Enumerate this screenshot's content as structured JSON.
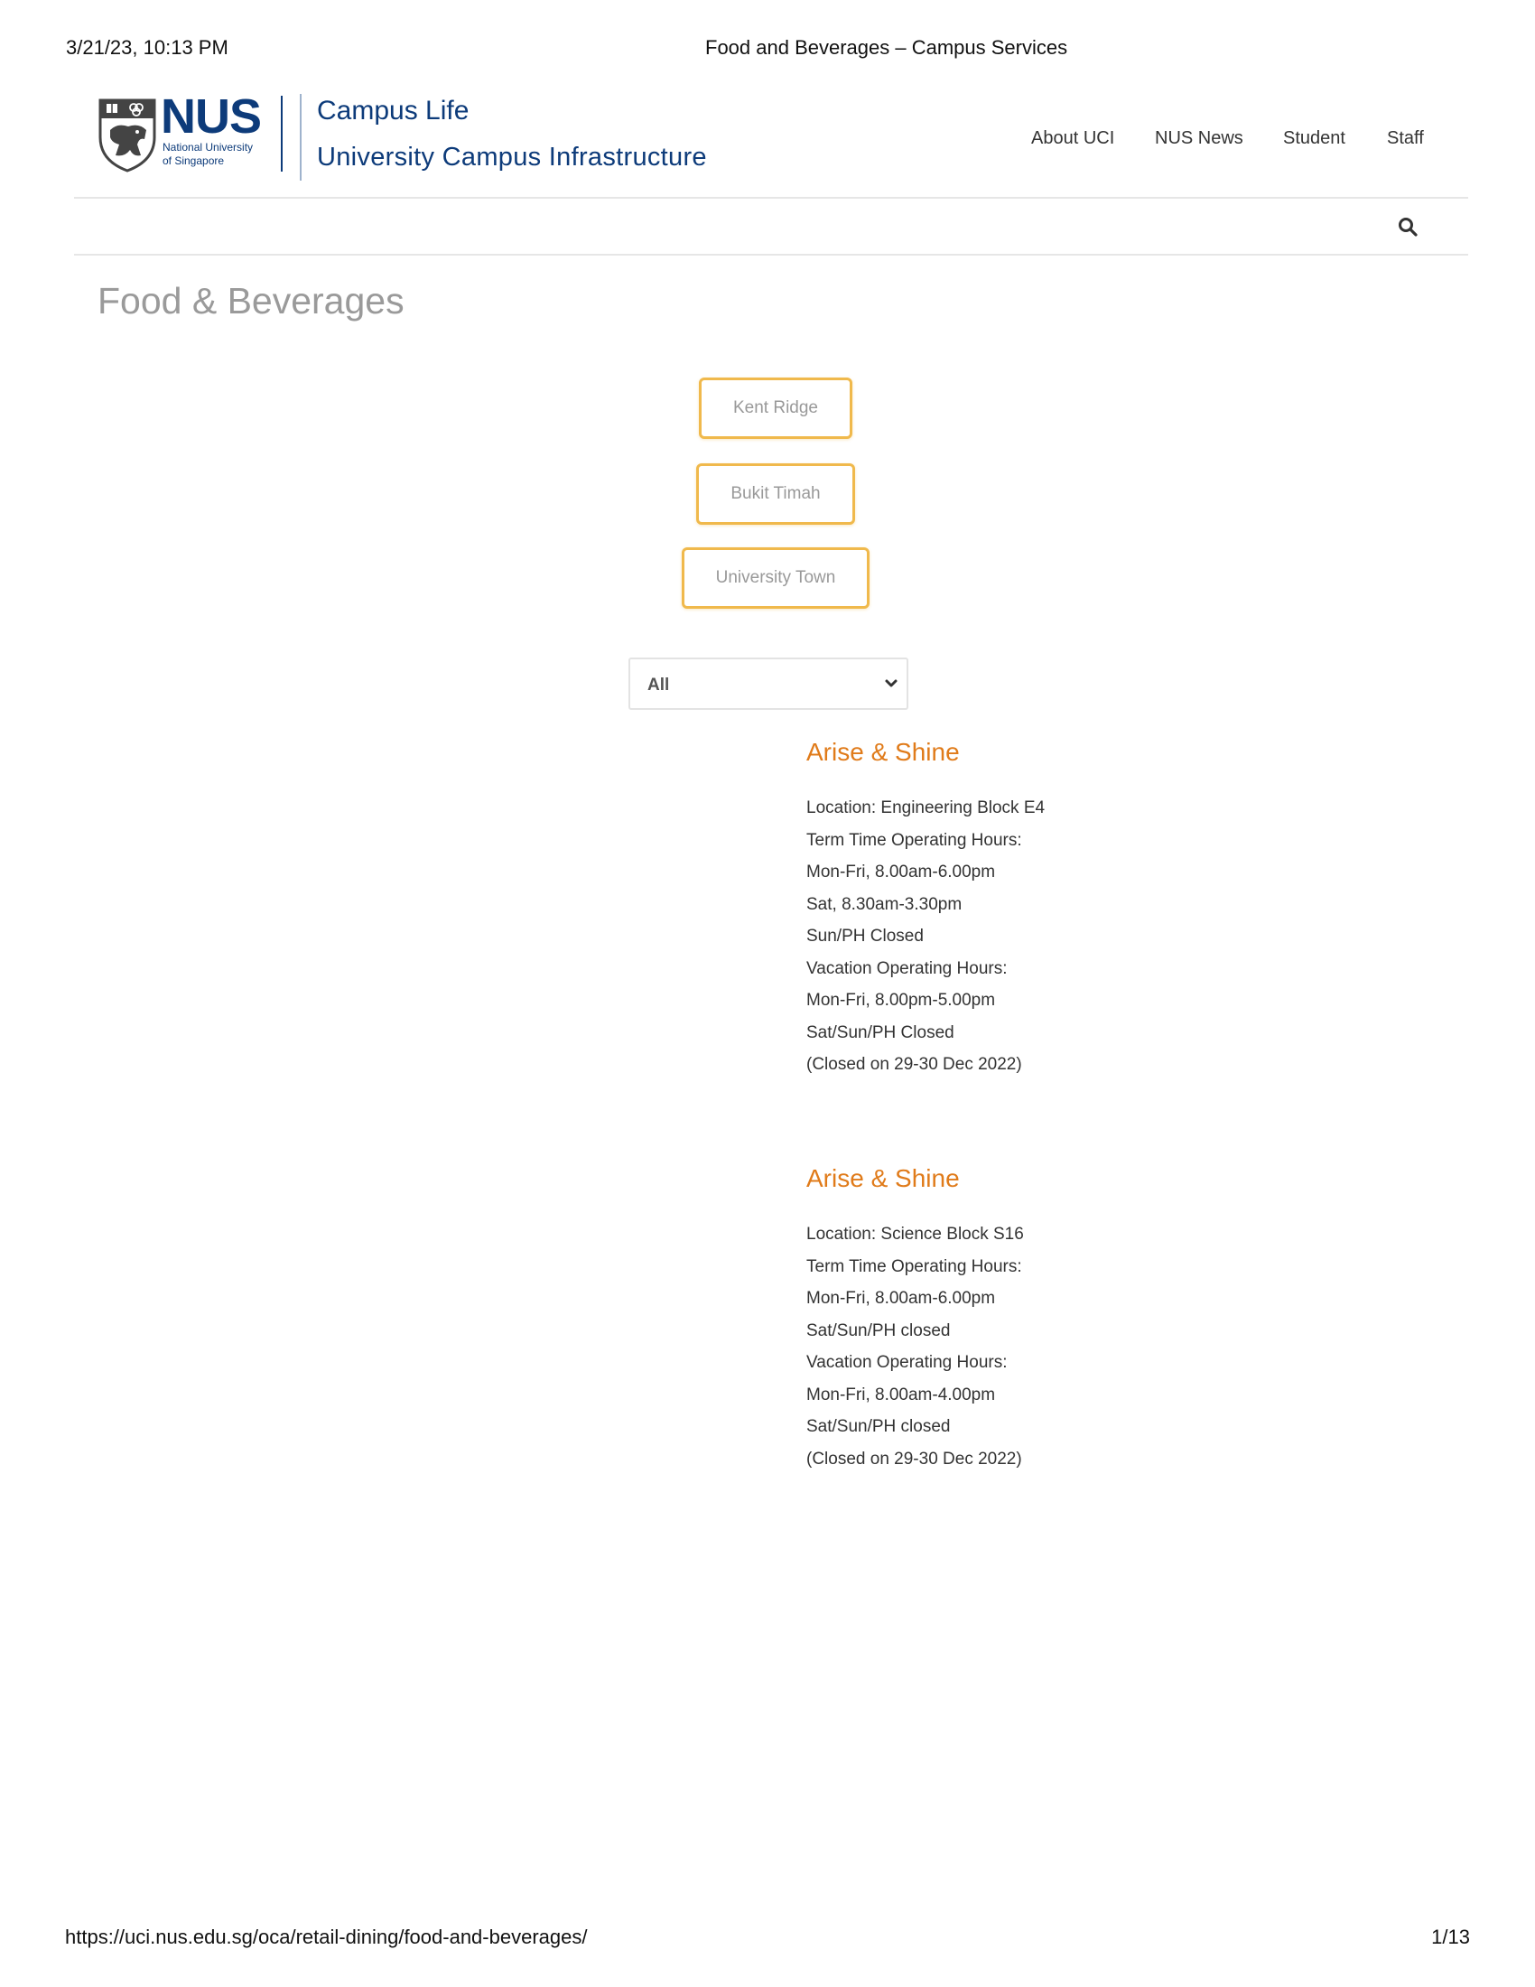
{
  "print_header": {
    "datetime": "3/21/23, 10:13 PM",
    "title": "Food and Beverages – Campus Services"
  },
  "logo": {
    "nus_text": "NUS",
    "nus_sub_line1": "National University",
    "nus_sub_line2": "of Singapore",
    "campus_life": "Campus Life",
    "uci_name": "University Campus Infrastructure"
  },
  "nav": {
    "items": [
      "About UCI",
      "NUS News",
      "Student",
      "Staff"
    ]
  },
  "search": {
    "icon": "search-icon"
  },
  "page_title": "Food & Beverages",
  "campus_buttons": [
    "Kent Ridge",
    "Bukit Timah",
    "University Town"
  ],
  "filter": {
    "selected": "All",
    "icon": "chevron-down-icon"
  },
  "outlets": [
    {
      "name": "Arise & Shine",
      "lines": [
        "Location: Engineering Block E4",
        "Term Time Operating Hours:",
        "Mon-Fri, 8.00am-6.00pm",
        "Sat, 8.30am-3.30pm",
        "Sun/PH Closed",
        "Vacation Operating Hours:",
        "Mon-Fri, 8.00pm-5.00pm",
        "Sat/Sun/PH Closed",
        "(Closed on 29-30 Dec 2022)"
      ]
    },
    {
      "name": "Arise & Shine",
      "lines": [
        "Location: Science Block S16",
        "Term Time Operating Hours:",
        "Mon-Fri, 8.00am-6.00pm",
        "Sat/Sun/PH closed",
        "Vacation Operating Hours:",
        "Mon-Fri, 8.00am-4.00pm",
        "Sat/Sun/PH closed",
        "(Closed on 29-30 Dec 2022)"
      ]
    }
  ],
  "print_footer": {
    "url": "https://uci.nus.edu.sg/oca/retail-dining/food-and-beverages/",
    "page": "1/13"
  },
  "colors": {
    "brand_blue": "#0d3b7a",
    "accent_orange": "#e07b1a",
    "button_border": "#f0b94c",
    "title_gray": "#9a9a9a"
  }
}
